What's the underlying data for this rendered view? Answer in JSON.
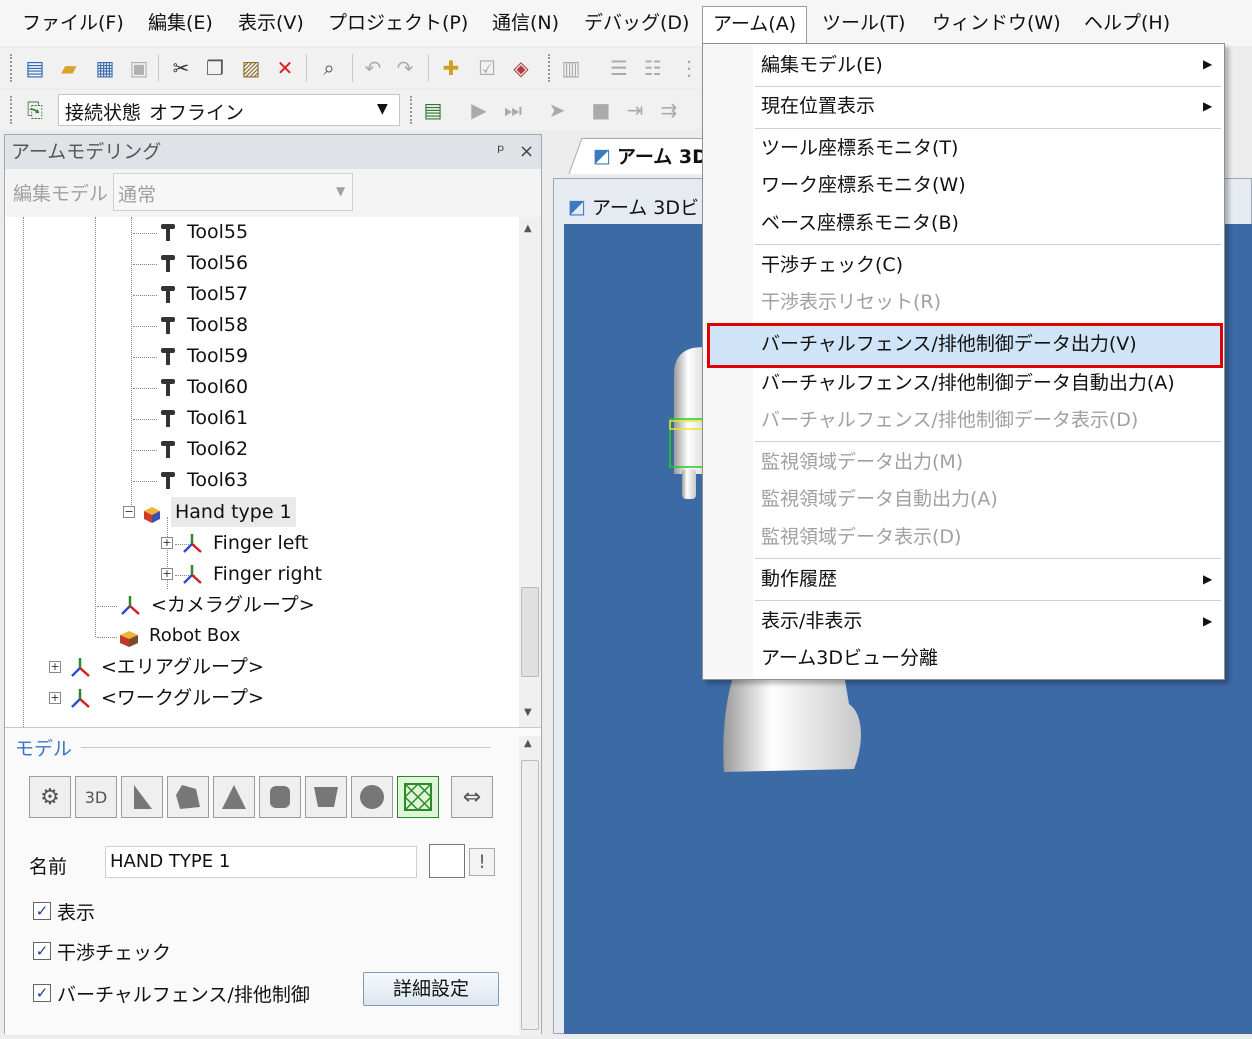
{
  "menubar": {
    "items": [
      "ファイル(F)",
      "編集(E)",
      "表示(V)",
      "プロジェクト(P)",
      "通信(N)",
      "デバッグ(D)",
      "アーム(A)",
      "ツール(T)",
      "ウィンドウ(W)",
      "ヘルプ(H)"
    ],
    "active_index": 6
  },
  "toolbar2": {
    "connection_label": "接続状態",
    "connection_value": "オフライン"
  },
  "left_panel": {
    "title": "アームモデリング",
    "pin": "ᵖ",
    "close": "×",
    "edit_model_label": "編集モデル",
    "edit_model_value": "通常"
  },
  "tree": {
    "tools": [
      "Tool55",
      "Tool56",
      "Tool57",
      "Tool58",
      "Tool59",
      "Tool60",
      "Tool61",
      "Tool62",
      "Tool63"
    ],
    "hand": "Hand type 1",
    "finger_left": "Finger left",
    "finger_right": "Finger right",
    "camera_group": "<カメラグループ>",
    "robot_box": "Robot Box",
    "area_group": "<エリアグループ>",
    "work_group": "<ワークグループ>"
  },
  "props": {
    "section_title": "モデル",
    "name_label": "名前",
    "name_value": "HAND TYPE 1",
    "warn": "!",
    "chk_display": "表示",
    "chk_collision": "干渉チェック",
    "chk_fence": "バーチャルフェンス/排他制御",
    "detail_button": "詳細設定"
  },
  "view": {
    "tab_label": "アーム 3D",
    "window_title": "アーム 3Dビ"
  },
  "dropdown": {
    "items": [
      {
        "label": "編集モデル(E)",
        "submenu": true,
        "disabled": false
      },
      {
        "label": "現在位置表示",
        "submenu": true,
        "disabled": false
      },
      {
        "label": "ツール座標系モニタ(T)",
        "submenu": false,
        "disabled": false
      },
      {
        "label": "ワーク座標系モニタ(W)",
        "submenu": false,
        "disabled": false
      },
      {
        "label": "ベース座標系モニタ(B)",
        "submenu": false,
        "disabled": false
      },
      {
        "label": "干渉チェック(C)",
        "submenu": false,
        "disabled": false
      },
      {
        "label": "干渉表示リセット(R)",
        "submenu": false,
        "disabled": true
      },
      {
        "label": "バーチャルフェンス/排他制御データ出力(V)",
        "submenu": false,
        "disabled": false,
        "highlighted": true
      },
      {
        "label": "バーチャルフェンス/排他制御データ自動出力(A)",
        "submenu": false,
        "disabled": false
      },
      {
        "label": "バーチャルフェンス/排他制御データ表示(D)",
        "submenu": false,
        "disabled": true
      },
      {
        "label": "監視領域データ出力(M)",
        "submenu": false,
        "disabled": true
      },
      {
        "label": "監視領域データ自動出力(A)",
        "submenu": false,
        "disabled": true
      },
      {
        "label": "監視領域データ表示(D)",
        "submenu": false,
        "disabled": true
      },
      {
        "label": "動作履歴",
        "submenu": true,
        "disabled": false
      },
      {
        "label": "表示/非表示",
        "submenu": true,
        "disabled": false
      },
      {
        "label": "アーム3Dビュー分離",
        "submenu": false,
        "disabled": false
      }
    ]
  },
  "colors": {
    "viewport": "#3c6aa5",
    "highlight_border": "#e00000",
    "highlight_fill": "#cfe5f7"
  }
}
